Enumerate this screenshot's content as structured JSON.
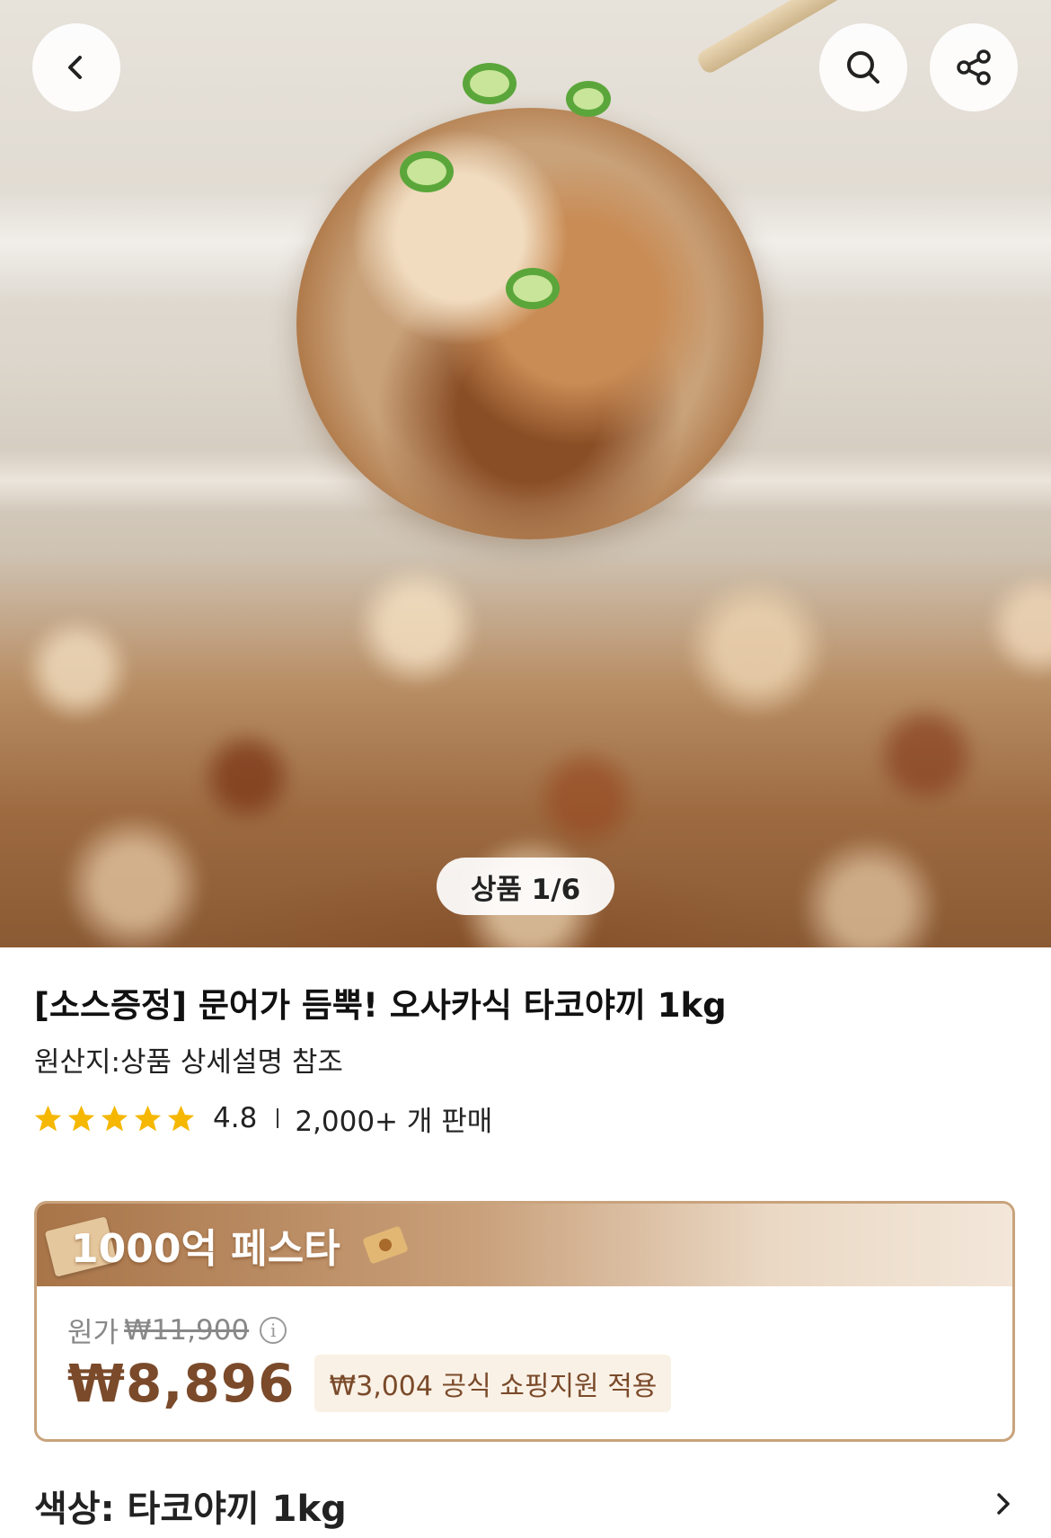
{
  "header": {
    "back_icon": "chevron-left-icon",
    "search_icon": "search-icon",
    "share_icon": "share-icon"
  },
  "gallery": {
    "counter": "상품 1/6"
  },
  "product": {
    "title": "[소스증정] 문어가 듬뿍! 오사카식 타코야끼 1kg",
    "origin": "원산지:상품 상세설명 참조",
    "rating": "4.8",
    "sold": "2,000+ 개 판매",
    "star_color": "#f5b700",
    "stars": 5
  },
  "promo": {
    "banner": "1000억 페스타",
    "original_label": "원가",
    "original_price": "₩11,900",
    "price": "₩8,896",
    "support_text": "₩3,004 공식 쇼핑지원 적용",
    "accent": "#7a4a2a"
  },
  "option": {
    "label": "색상: 타코야끼 1kg"
  }
}
